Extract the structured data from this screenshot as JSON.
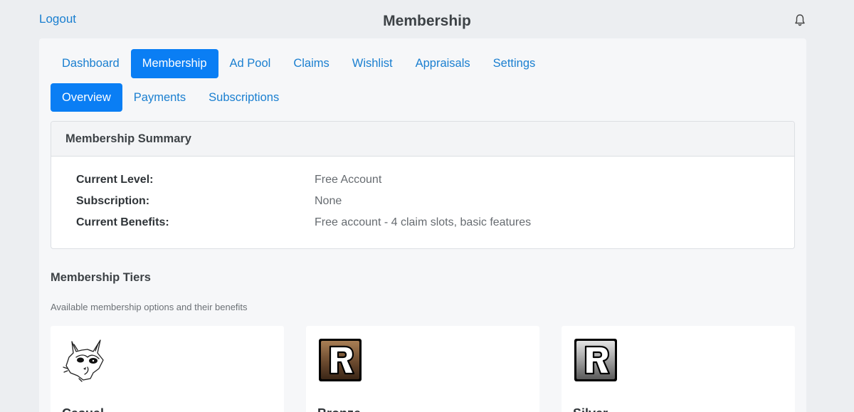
{
  "header": {
    "logout_label": "Logout",
    "title": "Membership",
    "notification_icon": "bell-icon"
  },
  "nav": {
    "tabs": [
      {
        "label": "Dashboard",
        "active": false
      },
      {
        "label": "Membership",
        "active": true
      },
      {
        "label": "Ad Pool",
        "active": false
      },
      {
        "label": "Claims",
        "active": false
      },
      {
        "label": "Wishlist",
        "active": false
      },
      {
        "label": "Appraisals",
        "active": false
      },
      {
        "label": "Settings",
        "active": false
      }
    ],
    "subtabs": [
      {
        "label": "Overview",
        "active": true
      },
      {
        "label": "Payments",
        "active": false
      },
      {
        "label": "Subscriptions",
        "active": false
      }
    ]
  },
  "summary": {
    "heading": "Membership Summary",
    "rows": [
      {
        "label": "Current Level:",
        "value": "Free Account"
      },
      {
        "label": "Subscription:",
        "value": "None"
      },
      {
        "label": "Current Benefits:",
        "value": "Free account - 4 claim slots, basic features"
      }
    ]
  },
  "tiers": {
    "heading": "Membership Tiers",
    "subheading": "Available membership options and their benefits",
    "cards": [
      {
        "icon": "raccoon-sketch-icon",
        "name": "Casual"
      },
      {
        "icon": "bronze-r-badge-icon",
        "name": "Bronze"
      },
      {
        "icon": "silver-r-badge-icon",
        "name": "Silver"
      }
    ]
  },
  "colors": {
    "accent": "#0a7ef4",
    "link": "#1a7fd0",
    "background": "#eceef1",
    "bronze_badge": "#6b4a2f",
    "silver_badge": "#9a9a9a"
  }
}
